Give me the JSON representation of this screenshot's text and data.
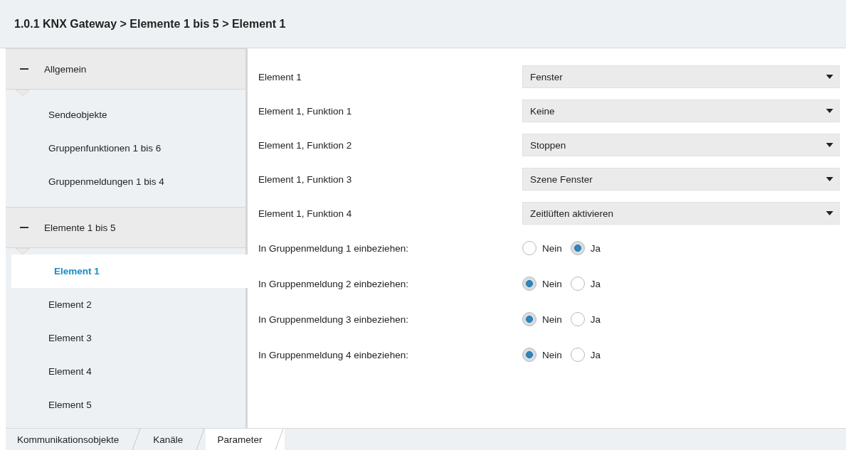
{
  "window": {
    "title": "1.0.1 KNX Gateway > Elemente 1 bis 5 > Element 1"
  },
  "sidebar": {
    "groups": [
      {
        "label": "Allgemein",
        "expanded": true,
        "children": [
          {
            "label": "Sendeobjekte",
            "selected": false
          },
          {
            "label": "Gruppenfunktionen 1 bis 6",
            "selected": false
          },
          {
            "label": "Gruppenmeldungen 1 bis 4",
            "selected": false
          }
        ]
      },
      {
        "label": "Elemente 1 bis 5",
        "expanded": true,
        "children": [
          {
            "label": "Element 1",
            "selected": true
          },
          {
            "label": "Element 2",
            "selected": false
          },
          {
            "label": "Element 3",
            "selected": false
          },
          {
            "label": "Element 4",
            "selected": false
          },
          {
            "label": "Element 5",
            "selected": false
          }
        ]
      }
    ]
  },
  "parameters": [
    {
      "kind": "dropdown",
      "label": "Element 1",
      "value": "Fenster"
    },
    {
      "kind": "dropdown",
      "label": "Element 1, Funktion 1",
      "value": "Keine"
    },
    {
      "kind": "dropdown",
      "label": "Element 1, Funktion 2",
      "value": "Stoppen"
    },
    {
      "kind": "dropdown",
      "label": "Element 1, Funktion 3",
      "value": "Szene Fenster"
    },
    {
      "kind": "dropdown",
      "label": "Element 1, Funktion 4",
      "value": "Zeitlüften aktivieren"
    },
    {
      "kind": "radio",
      "label": "In Gruppenmeldung 1 einbeziehen:",
      "options": [
        {
          "label": "Nein",
          "selected": false
        },
        {
          "label": "Ja",
          "selected": true
        }
      ]
    },
    {
      "kind": "radio",
      "label": "In Gruppenmeldung 2 einbeziehen:",
      "options": [
        {
          "label": "Nein",
          "selected": true
        },
        {
          "label": "Ja",
          "selected": false
        }
      ]
    },
    {
      "kind": "radio",
      "label": "In Gruppenmeldung 3 einbeziehen:",
      "options": [
        {
          "label": "Nein",
          "selected": true
        },
        {
          "label": "Ja",
          "selected": false
        }
      ]
    },
    {
      "kind": "radio",
      "label": "In Gruppenmeldung 4 einbeziehen:",
      "options": [
        {
          "label": "Nein",
          "selected": true
        },
        {
          "label": "Ja",
          "selected": false
        }
      ]
    }
  ],
  "tabs": [
    {
      "label": "Kommunikationsobjekte",
      "selected": false
    },
    {
      "label": "Kanäle",
      "selected": false
    },
    {
      "label": "Parameter",
      "selected": true
    }
  ]
}
